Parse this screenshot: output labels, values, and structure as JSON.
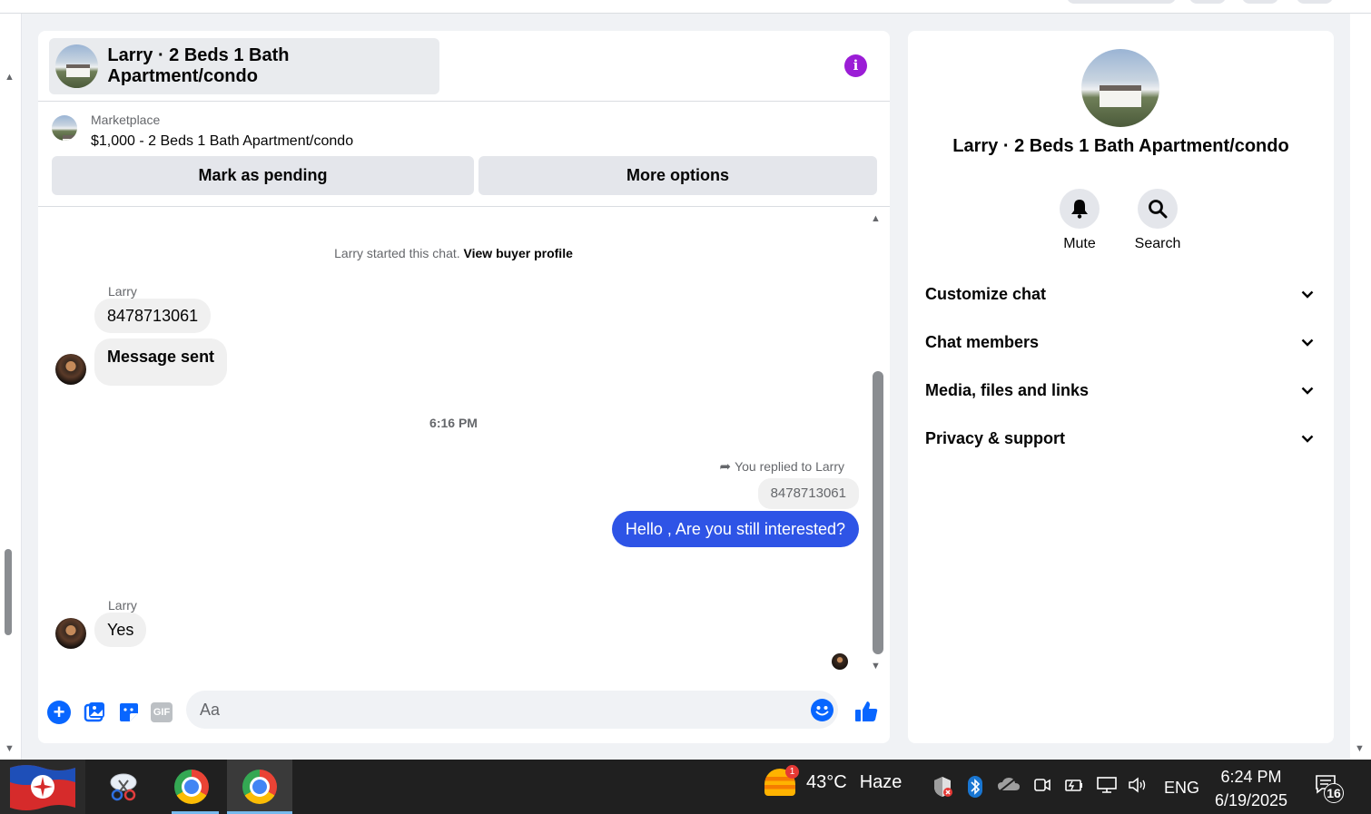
{
  "chat": {
    "title": "Larry · 2 Beds 1 Bath Apartment/condo",
    "listing_label": "Marketplace",
    "listing_price_title": "$1,000 - 2 Beds 1 Bath Apartment/condo",
    "mark_pending_label": "Mark as pending",
    "more_options_label": "More options",
    "system_note_prefix": "Larry started this chat.",
    "system_note_link": "View buyer profile",
    "sender_name": "Larry",
    "messages_in_1": [
      "8478713061",
      "Message sent"
    ],
    "time_divider": "6:16 PM",
    "replied_label": "You replied to Larry",
    "quoted_text": "8478713061",
    "outgoing_text": "Hello , Are you still interested?",
    "sender_name_2": "Larry",
    "message_in_2": "Yes",
    "composer_placeholder": "Aa",
    "composer_gif_label": "GIF"
  },
  "info": {
    "name": "Larry · 2 Beds 1 Bath Apartment/condo",
    "mute_label": "Mute",
    "search_label": "Search",
    "sections": [
      "Customize chat",
      "Chat members",
      "Media, files and links",
      "Privacy & support"
    ]
  },
  "taskbar": {
    "weather_badge": "1",
    "temperature": "43°C",
    "condition": "Haze",
    "language": "ENG",
    "time": "6:24 PM",
    "date": "6/19/2025",
    "notification_count": "16"
  },
  "colors": {
    "accent_blue": "#0866ff",
    "outgoing_bubble": "#2e54e6",
    "info_purple": "#9b1dd6"
  }
}
